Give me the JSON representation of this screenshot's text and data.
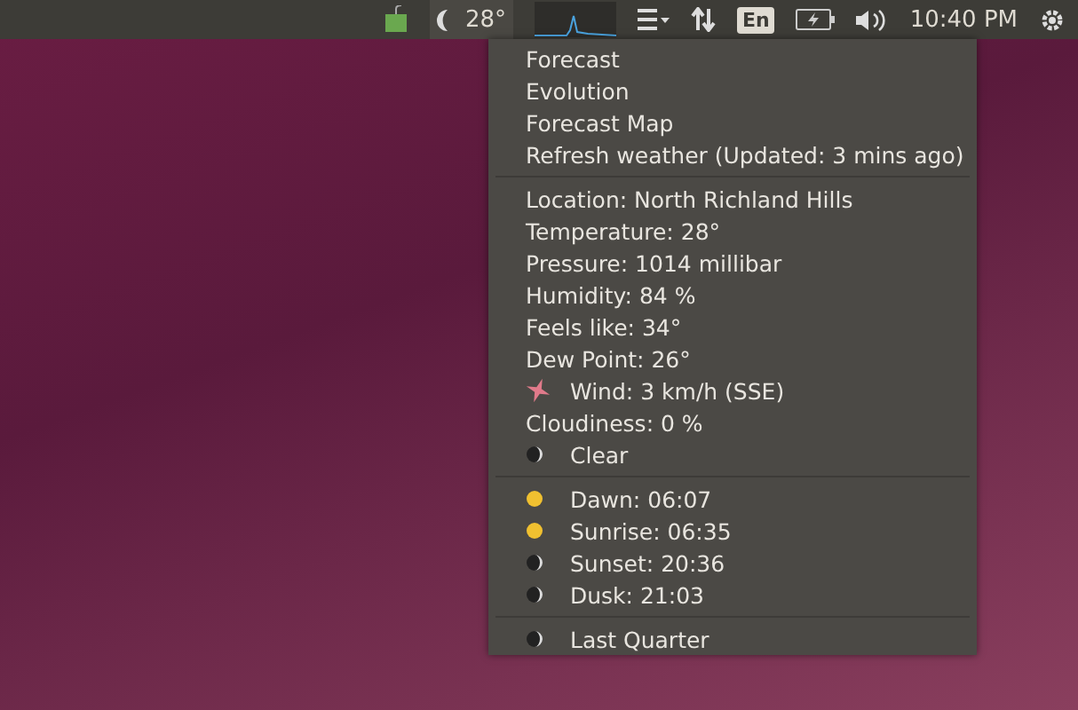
{
  "top_bar": {
    "temperature": "28°",
    "keyboard_layout": "En",
    "clock": "10:40 PM"
  },
  "menu": {
    "sections": [
      [
        {
          "label": "Forecast",
          "kind": "text"
        },
        {
          "label": "Evolution",
          "kind": "text"
        },
        {
          "label": "Forecast Map",
          "kind": "text"
        },
        {
          "label": "Refresh weather (Updated: 3 mins ago)",
          "kind": "text"
        }
      ],
      [
        {
          "label": "Location: North Richland Hills",
          "kind": "text"
        },
        {
          "label": "Temperature: 28°",
          "kind": "text"
        },
        {
          "label": "Pressure: 1014 millibar",
          "kind": "text"
        },
        {
          "label": "Humidity: 84 %",
          "kind": "text"
        },
        {
          "label": "Feels like: 34°",
          "kind": "text"
        },
        {
          "label": "Dew Point: 26°",
          "kind": "text"
        },
        {
          "label": "Wind: 3 km/h (SSE)",
          "kind": "wind"
        },
        {
          "label": "Cloudiness: 0 %",
          "kind": "text"
        },
        {
          "label": "Clear",
          "kind": "moon"
        }
      ],
      [
        {
          "label": "Dawn: 06:07",
          "kind": "sun"
        },
        {
          "label": "Sunrise: 06:35",
          "kind": "sun"
        },
        {
          "label": "Sunset: 20:36",
          "kind": "moon"
        },
        {
          "label": "Dusk: 21:03",
          "kind": "moon"
        }
      ],
      [
        {
          "label": "Last Quarter",
          "kind": "moon"
        }
      ]
    ]
  }
}
